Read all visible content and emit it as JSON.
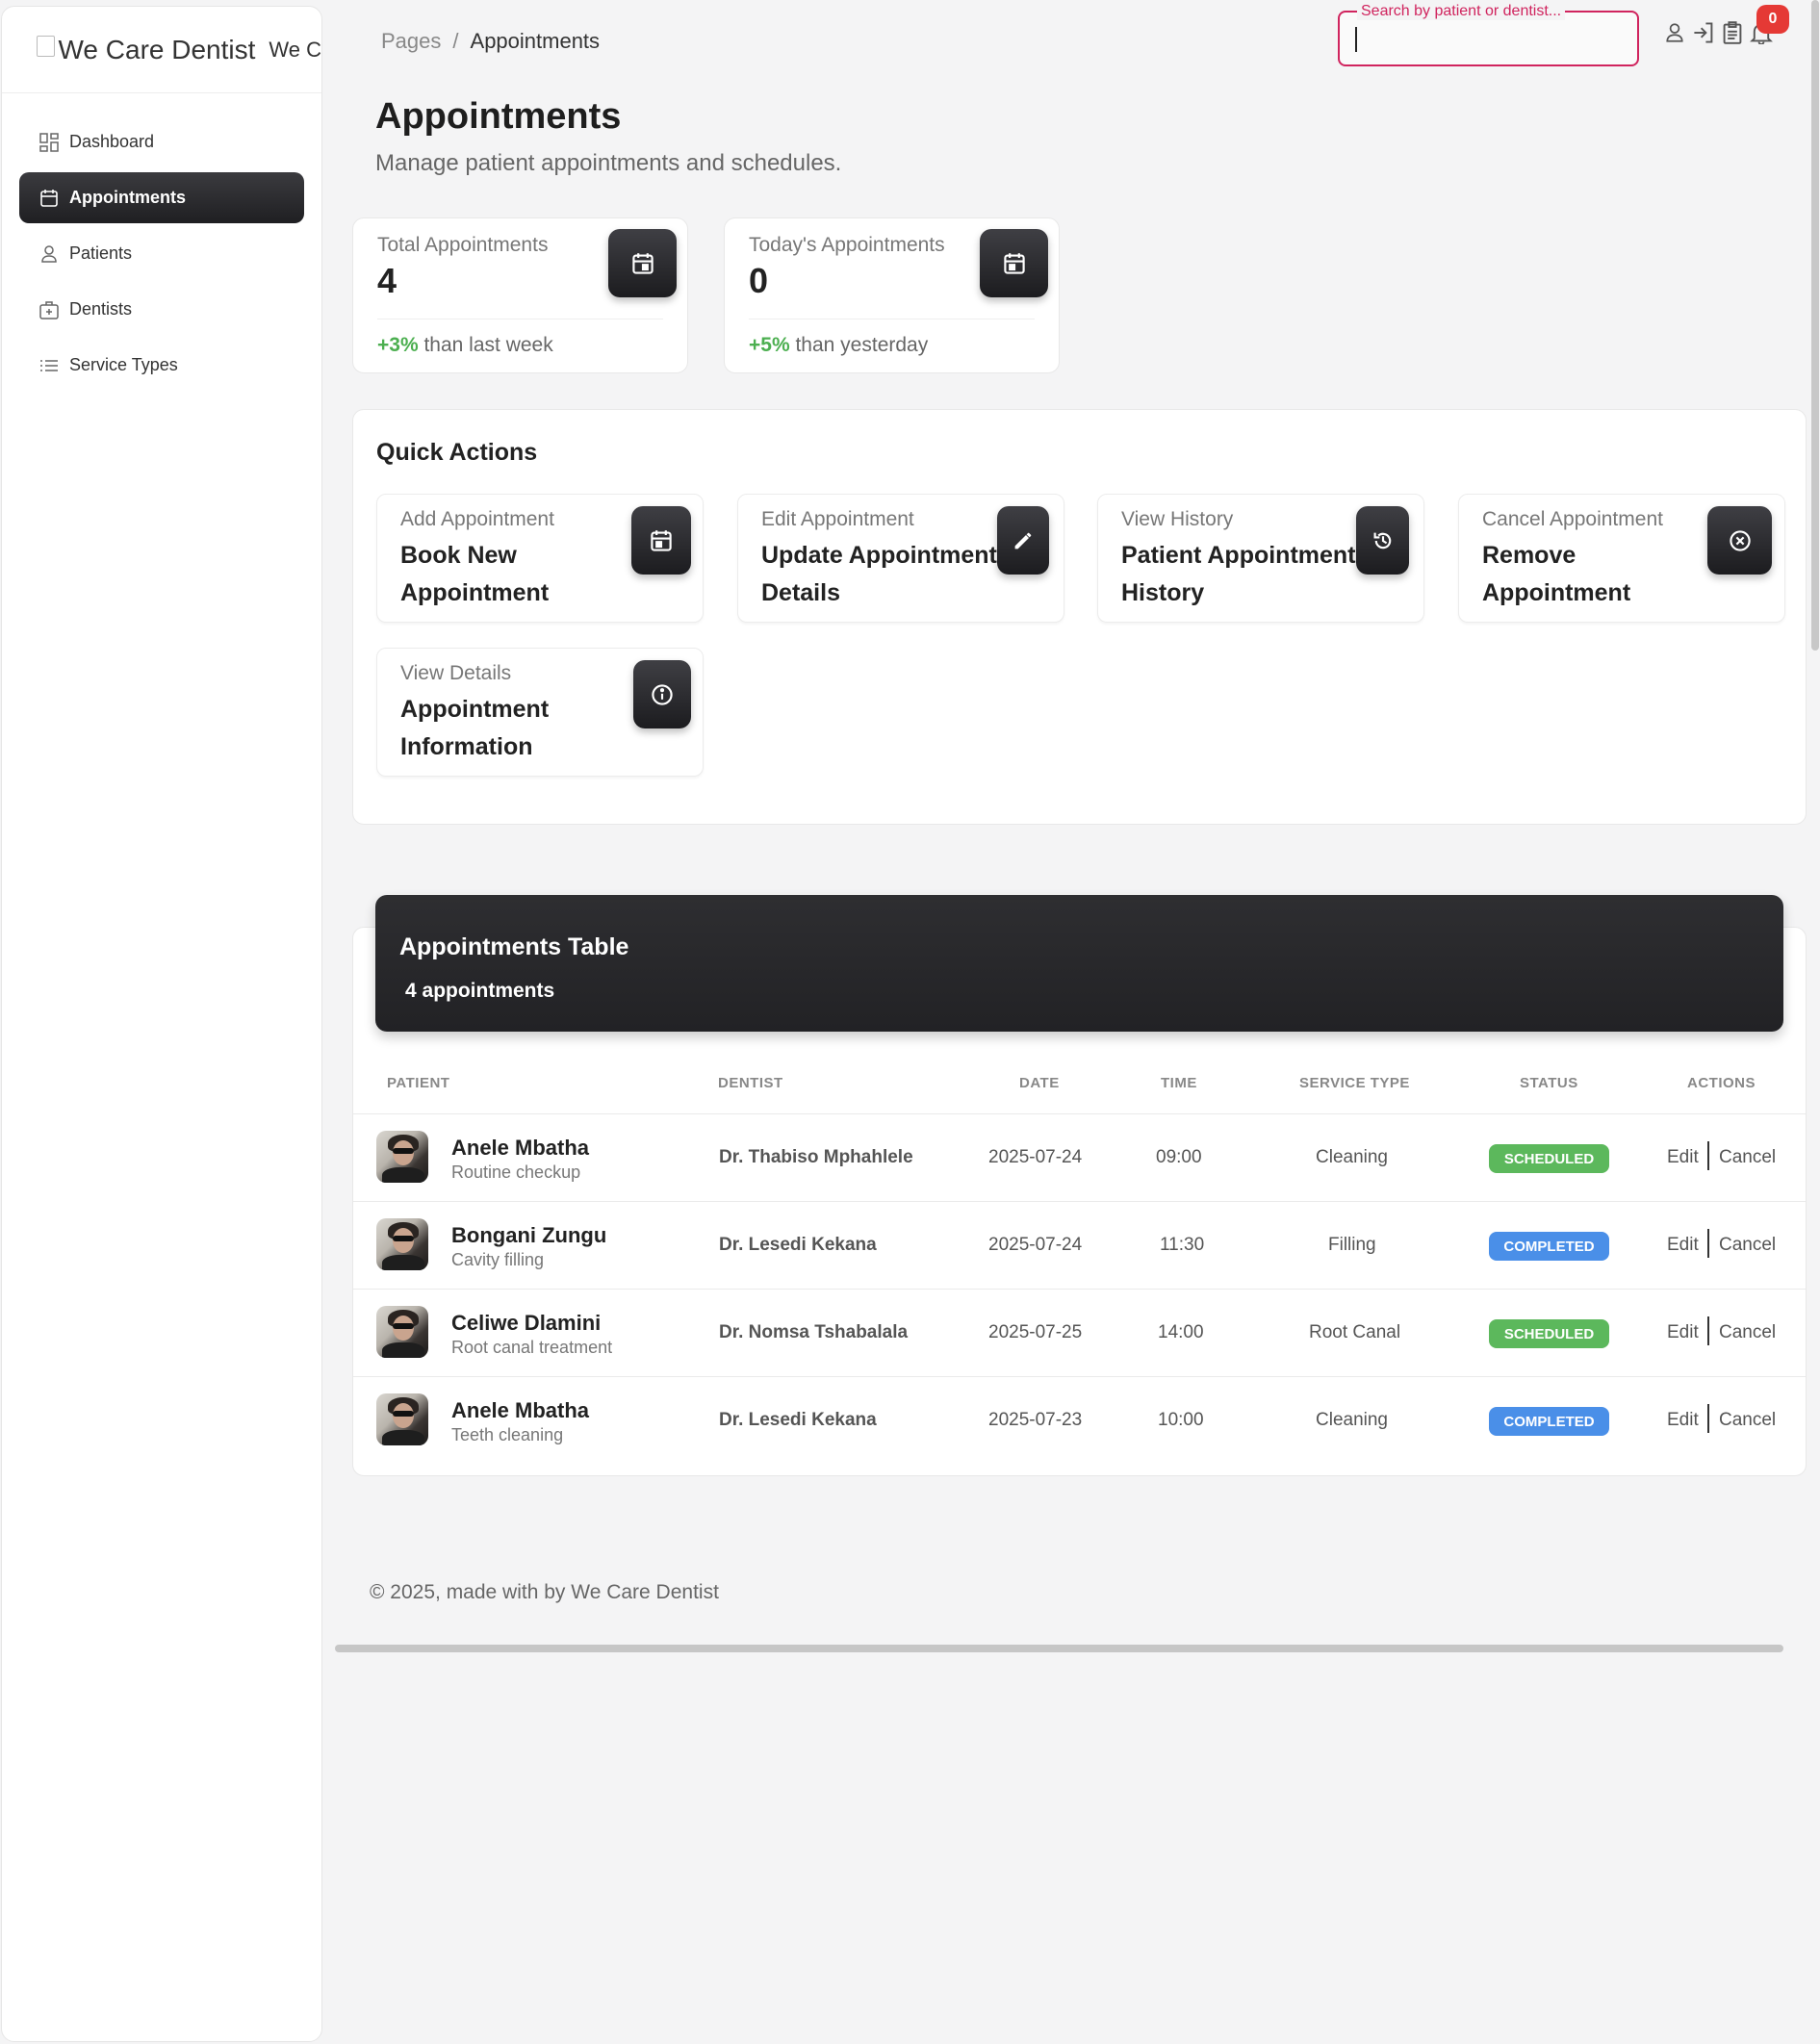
{
  "sidebar": {
    "logo_alt": "We Care Dentist",
    "brand_name": "We C",
    "items": [
      {
        "label": "Dashboard"
      },
      {
        "label": "Appointments"
      },
      {
        "label": "Patients"
      },
      {
        "label": "Dentists"
      },
      {
        "label": "Service Types"
      }
    ]
  },
  "header": {
    "breadcrumb": {
      "root": "Pages",
      "sep": "/",
      "current": "Appointments"
    },
    "search": {
      "label": "Search by patient or dentist...",
      "value": ""
    },
    "notifications_count": "0"
  },
  "page": {
    "title": "Appointments",
    "subtitle": "Manage patient appointments and schedules."
  },
  "stats": [
    {
      "label": "Total Appointments",
      "value": "4",
      "delta": "+3%",
      "suffix": "than last week"
    },
    {
      "label": "Today's Appointments",
      "value": "0",
      "delta": "+5%",
      "suffix": "than yesterday"
    }
  ],
  "quick_actions": {
    "title": "Quick Actions",
    "items": [
      {
        "label": "Add Appointment",
        "value": "Book New Appointment"
      },
      {
        "label": "Edit Appointment",
        "value": "Update Appointment Details"
      },
      {
        "label": "View History",
        "value": "Patient Appointment History"
      },
      {
        "label": "Cancel Appointment",
        "value": "Remove Appointment"
      },
      {
        "label": "View Details",
        "value": "Appointment Information"
      }
    ]
  },
  "table": {
    "title": "Appointments Table",
    "count": "4 appointments",
    "columns": {
      "patient": "PATIENT",
      "dentist": "DENTIST",
      "date": "DATE",
      "time": "TIME",
      "service": "SERVICE TYPE",
      "status": "STATUS",
      "actions": "ACTIONS"
    },
    "rows": [
      {
        "name": "Anele Mbatha",
        "desc": "Routine checkup",
        "dentist": "Dr. Thabiso Mphahlele",
        "date": "2025-07-24",
        "time": "09:00",
        "service": "Cleaning",
        "status": "SCHEDULED",
        "edit": "Edit",
        "cancel": "Cancel"
      },
      {
        "name": "Bongani Zungu",
        "desc": "Cavity filling",
        "dentist": "Dr. Lesedi Kekana",
        "date": "2025-07-24",
        "time": "11:30",
        "service": "Filling",
        "status": "COMPLETED",
        "edit": "Edit",
        "cancel": "Cancel"
      },
      {
        "name": "Celiwe Dlamini",
        "desc": "Root canal treatment",
        "dentist": "Dr. Nomsa Tshabalala",
        "date": "2025-07-25",
        "time": "14:00",
        "service": "Root Canal",
        "status": "SCHEDULED",
        "edit": "Edit",
        "cancel": "Cancel"
      },
      {
        "name": "Anele Mbatha",
        "desc": "Teeth cleaning",
        "dentist": "Dr. Lesedi Kekana",
        "date": "2025-07-23",
        "time": "10:00",
        "service": "Cleaning",
        "status": "COMPLETED",
        "edit": "Edit",
        "cancel": "Cancel"
      }
    ]
  },
  "status_colors": {
    "SCHEDULED": "#5cb85c",
    "COMPLETED": "#4a8fe8"
  },
  "accent_positive": "#4caf50",
  "footer": "© 2025, made with by We Care Dentist"
}
